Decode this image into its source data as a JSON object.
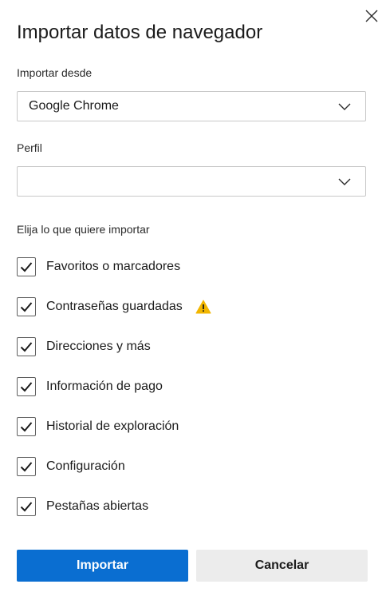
{
  "dialog": {
    "title": "Importar datos de navegador"
  },
  "import_from": {
    "label": "Importar desde",
    "value": "Google Chrome"
  },
  "profile": {
    "label": "Perfil",
    "value": ""
  },
  "choose": {
    "label": "Elija lo que quiere importar",
    "items": [
      {
        "label": "Favoritos o marcadores",
        "checked": true
      },
      {
        "label": "Contraseñas guardadas",
        "checked": true,
        "icon": "warning-icon"
      },
      {
        "label": "Direcciones y más",
        "checked": true
      },
      {
        "label": "Información de pago",
        "checked": true
      },
      {
        "label": "Historial de exploración",
        "checked": true
      },
      {
        "label": "Configuración",
        "checked": true
      },
      {
        "label": "Pestañas abiertas",
        "checked": true
      }
    ]
  },
  "buttons": {
    "import_label": "Importar",
    "cancel_label": "Cancelar"
  },
  "colors": {
    "primary": "#0a6ed1",
    "secondary": "#ececec",
    "warning": "#f2b600"
  }
}
